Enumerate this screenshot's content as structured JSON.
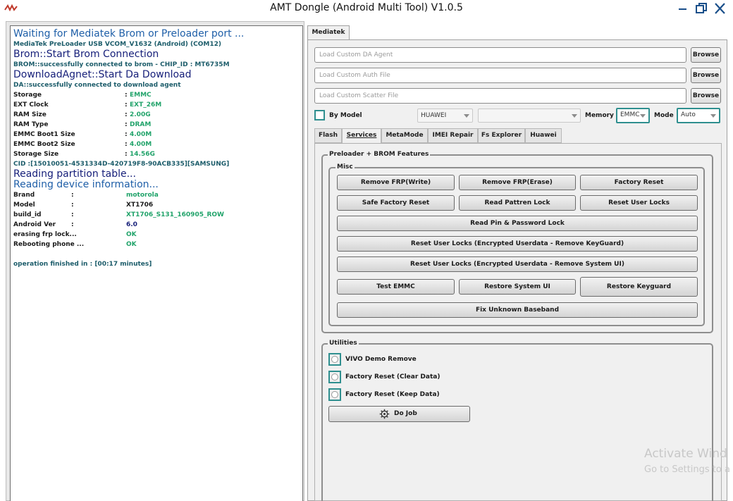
{
  "window": {
    "title": "AMT Dongle (Android Multi Tool) V1.0.5",
    "minimize_icon": "minimize-icon",
    "restore_icon": "restore-icon",
    "close_icon": "close-icon"
  },
  "log": {
    "lines": {
      "l1": "Waiting for Mediatek Brom or Preloader port ...",
      "l2": "MediaTek PreLoader USB VCOM_V1632 (Android) (COM12)",
      "l3": "Brom::Start Brom Connection",
      "l4": "BROM::successfully connected to brom - CHIP_ID : MT6735M",
      "l5": "DownloadAgnet::Start Da Download",
      "l6": "DA::successfully connected to download agent",
      "cid": "CID :[15010051-4531334D-420719F8-90ACB335][SAMSUNG]",
      "l7": "Reading partition table...",
      "l8": "Reading device information...",
      "finished": "operation finished in : [00:17 minutes]"
    },
    "storage_info": [
      {
        "key": "Storage",
        "sep": ":",
        "value": "EMMC"
      },
      {
        "key": "EXT Clock",
        "sep": ":",
        "value": "EXT_26M"
      },
      {
        "key": "RAM Size",
        "sep": ":",
        "value": "2.00G"
      },
      {
        "key": "RAM Type",
        "sep": ":",
        "value": "DRAM"
      },
      {
        "key": "EMMC Boot1 Size",
        "sep": ":",
        "value": "4.00M"
      },
      {
        "key": "EMMC Boot2 Size",
        "sep": ":",
        "value": "4.00M"
      },
      {
        "key": "Storage Size",
        "sep": ":",
        "value": "14.56G"
      }
    ],
    "device_info": [
      {
        "key": "Brand",
        "sep": ":",
        "value": "motorola"
      },
      {
        "key": "Model",
        "sep": ":",
        "value": "XT1706"
      },
      {
        "key": "build_id",
        "sep": ":",
        "value": "XT1706_S131_160905_ROW"
      },
      {
        "key": "Android Ver",
        "sep": ":",
        "value": "6.0"
      },
      {
        "key": "erasing frp lock...",
        "sep": "",
        "value": "OK"
      },
      {
        "key": "Rebooting phone ...",
        "sep": "",
        "value": "OK"
      }
    ]
  },
  "tabs": {
    "main": "Mediatek",
    "sub": [
      "Flash",
      "Services",
      "MetaMode",
      "IMEI Repair",
      "Fs Explorer",
      "Huawei"
    ]
  },
  "files": {
    "da_placeholder": "Load Custom DA Agent",
    "auth_placeholder": "Load Custom Auth File",
    "scatter_placeholder": "Load Custom Scatter File",
    "browse_label": "Browse"
  },
  "options": {
    "by_model_label": "By Model",
    "brand_value": "HUAWEI",
    "model_value": "",
    "memory_label": "Memory",
    "memory_value": "EMMC",
    "mode_label": "Mode",
    "mode_value": "Auto"
  },
  "features": {
    "group_title": "Preloader + BROM Features",
    "misc_title": "Misc",
    "buttons": {
      "remove_frp_write": "Remove FRP(Write)",
      "remove_frp_erase": "Remove FRP(Erase)",
      "factory_reset": "Factory Reset",
      "safe_factory_reset": "Safe Factory Reset",
      "read_pattren_lock": "Read Pattren Lock",
      "reset_user_locks": "Reset User Locks",
      "read_pin_password": "Read Pin & Password Lock",
      "reset_locks_keyguard": "Reset User Locks (Encrypted Userdata - Remove KeyGuard)",
      "reset_locks_systemui": "Reset User Locks (Encrypted Userdata - Remove System UI)",
      "test_emmc": "Test EMMC",
      "restore_system_ui": "Restore System UI",
      "restore_keyguard": "Restore Keyguard",
      "fix_baseband": "Fix Unknown Baseband"
    }
  },
  "utilities": {
    "title": "Utilities",
    "options": [
      "VIVO Demo Remove",
      "Factory Reset (Clear Data)",
      "Factory Reset (Keep Data)"
    ],
    "do_job_label": "Do Job",
    "do_job_icon": "gear-icon"
  },
  "watermark": {
    "line1": "Activate Wind",
    "line2": "Go to Settings to a"
  },
  "colors": {
    "log_blue": "#1f5fa8",
    "log_navy": "#17207a",
    "log_green": "#21a36a",
    "accent_teal": "#2f8f8f",
    "window_icons": "#1a4f8a"
  }
}
